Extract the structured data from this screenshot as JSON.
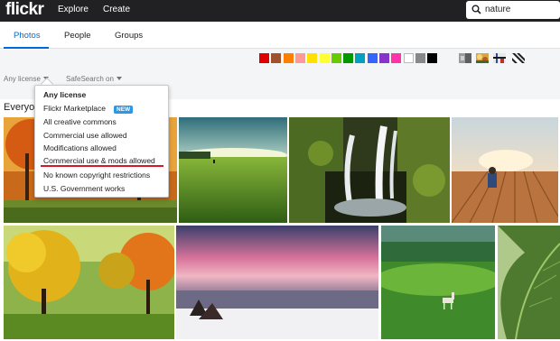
{
  "topbar": {
    "logo": "flickr",
    "nav": [
      "Explore",
      "Create"
    ],
    "search_value": "nature"
  },
  "tabs": [
    {
      "label": "Photos",
      "active": true
    },
    {
      "label": "People",
      "active": false
    },
    {
      "label": "Groups",
      "active": false
    }
  ],
  "color_swatches": [
    "#e00000",
    "#a0522d",
    "#ff7f00",
    "#ff9999",
    "#ffe000",
    "#ffff33",
    "#66cc00",
    "#009900",
    "#00a0c0",
    "#3366ff",
    "#8833cc",
    "#ff33aa",
    "#ffffff",
    "#888888",
    "#000000"
  ],
  "style_filters": [
    "black-and-white-icon",
    "shallow-depth-icon",
    "minimalist-icon",
    "patterns-icon"
  ],
  "filters": {
    "license_label": "Any license",
    "safesearch_label": "SafeSearch on"
  },
  "section_heading": "Everyon",
  "license_menu": {
    "items": [
      "Any license",
      "Flickr Marketplace",
      "All creative commons",
      "Commercial use allowed",
      "Modifications allowed",
      "Commercial use & mods allowed",
      "No known copyright restrictions",
      "U.S. Government works"
    ],
    "new_badge": "NEW",
    "highlighted_index": 5
  },
  "photos": [
    "autumn-park-photo",
    "green-meadow-photo",
    "mossy-waterfall-photo",
    "pier-sitting-person-photo",
    "yellow-autumn-trees-photo",
    "pink-sunset-lake-photo",
    "deer-in-field-photo",
    "leaf-closeup-photo"
  ]
}
